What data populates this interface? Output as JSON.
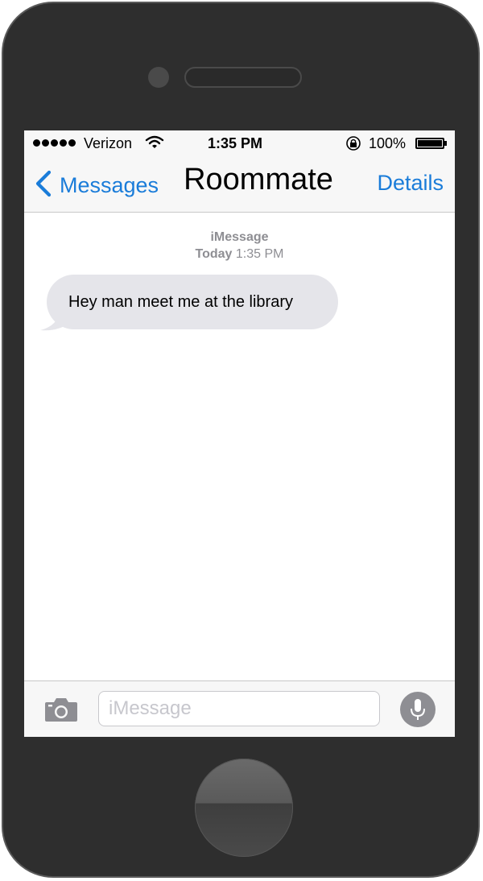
{
  "status_bar": {
    "carrier": "Verizon",
    "time": "1:35 PM",
    "battery_percent": "100%",
    "signal_bars": 5,
    "icons": [
      "wifi-icon",
      "rotation-lock-icon",
      "battery-icon"
    ]
  },
  "nav": {
    "back_label": "Messages",
    "title": "Roommate",
    "details_label": "Details"
  },
  "conversation": {
    "service": "iMessage",
    "timestamp_day": "Today",
    "timestamp_time": "1:35 PM",
    "messages": [
      {
        "text": "Hey man meet me at the library",
        "direction": "incoming"
      }
    ]
  },
  "composer": {
    "placeholder": "iMessage",
    "value": "",
    "icons": [
      "camera-icon",
      "microphone-icon"
    ]
  },
  "colors": {
    "accent": "#1a7cd9",
    "bubble_incoming": "#e5e5ea",
    "phone_body": "#2e2e2e"
  }
}
